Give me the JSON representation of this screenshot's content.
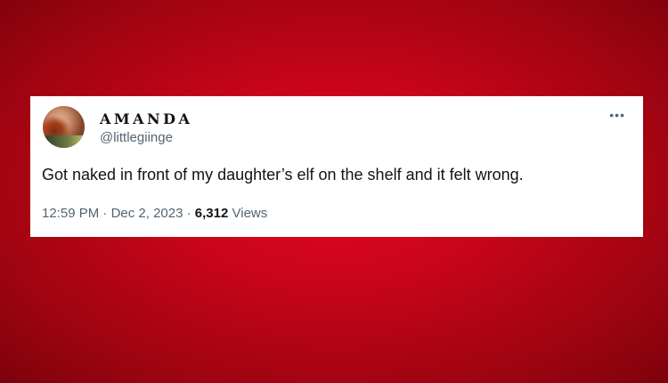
{
  "tweet": {
    "display_name": "AMANDA",
    "handle": "@littlegiinge",
    "more_icon": "more-horizontal-icon",
    "text": "Got naked in front of my daughter’s elf on the shelf and it felt wrong.",
    "time": "12:59 PM",
    "separator": "·",
    "date": "Dec 2, 2023",
    "views_count": "6,312",
    "views_label": "Views"
  },
  "colors": {
    "background": "#c9051a",
    "card": "#ffffff",
    "text_primary": "#0f1419",
    "text_secondary": "#536471"
  }
}
